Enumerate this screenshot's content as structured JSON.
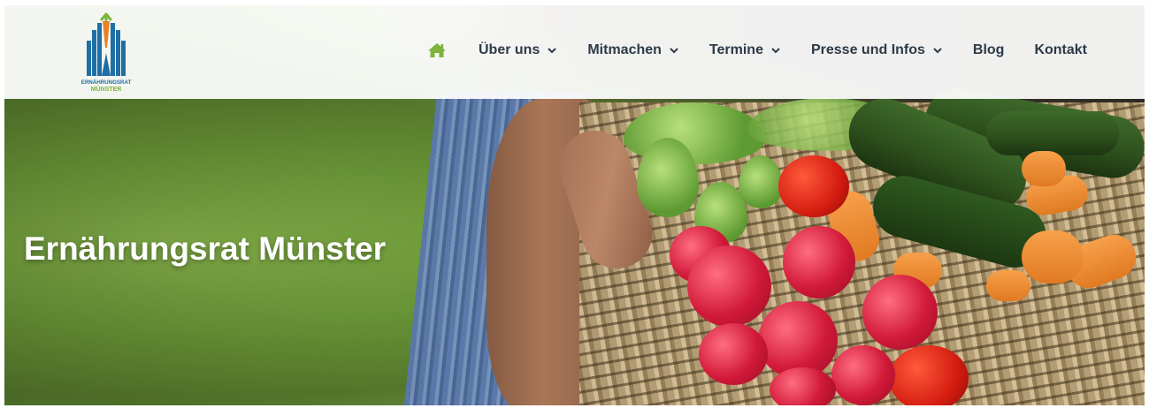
{
  "brand": {
    "logo_line1": "ERNÄHRUNGSRAT",
    "logo_line2": "MÜNSTER",
    "colors": {
      "blue": "#1f6fa5",
      "green": "#7bb33c",
      "orange": "#e8822a"
    }
  },
  "nav": {
    "home_icon": "home-icon",
    "items": [
      {
        "label": "Über uns",
        "dropdown": true
      },
      {
        "label": "Mitmachen",
        "dropdown": true
      },
      {
        "label": "Termine",
        "dropdown": true
      },
      {
        "label": "Presse und Infos",
        "dropdown": true
      },
      {
        "label": "Blog",
        "dropdown": false
      },
      {
        "label": "Kontakt",
        "dropdown": false
      }
    ],
    "text_color": "#2d3a47",
    "accent_color": "#7bb33c"
  },
  "hero": {
    "title": "Ernährungsrat Münster",
    "image": "hand carrying basket of vegetables"
  }
}
